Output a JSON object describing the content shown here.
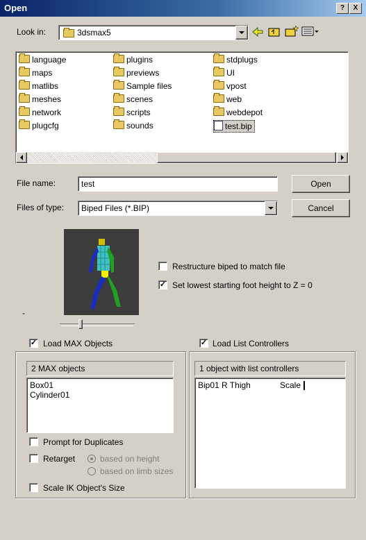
{
  "window": {
    "title": "Open",
    "help_btn": "?",
    "close_btn": "X"
  },
  "look_in": {
    "label": "Look in:",
    "value": "3dsmax5"
  },
  "files": {
    "col1": [
      "language",
      "maps",
      "matlibs",
      "meshes",
      "network",
      "plugcfg"
    ],
    "col2": [
      "plugins",
      "previews",
      "Sample files",
      "scenes",
      "scripts",
      "sounds"
    ],
    "col3": [
      "stdplugs",
      "UI",
      "vpost",
      "web",
      "webdepot"
    ],
    "selected_file": "test.bip"
  },
  "file_name": {
    "label": "File name:",
    "value": "test"
  },
  "files_of_type": {
    "label": "Files of type:",
    "value": "Biped Files (*.BIP)"
  },
  "buttons": {
    "open": "Open",
    "cancel": "Cancel"
  },
  "options": {
    "restructure": "Restructure biped to match file",
    "lowest_foot": "Set lowest starting foot height to Z = 0",
    "restructure_checked": false,
    "lowest_foot_checked": true
  },
  "left_panel": {
    "check_label": "Load MAX Objects",
    "header": "2 MAX objects",
    "items": [
      "Box01",
      "Cylinder01"
    ],
    "prompt": "Prompt for Duplicates",
    "retarget": "Retarget",
    "based_height": "based on height",
    "based_limb": "based on limb sizes",
    "scale_ik": "Scale IK Object's Size"
  },
  "right_panel": {
    "check_label": "Load List Controllers",
    "header": "1 object with list controllers",
    "row_name": "Bip01 R Thigh",
    "row_value": "Scale"
  },
  "misc": {
    "dash": "-"
  }
}
